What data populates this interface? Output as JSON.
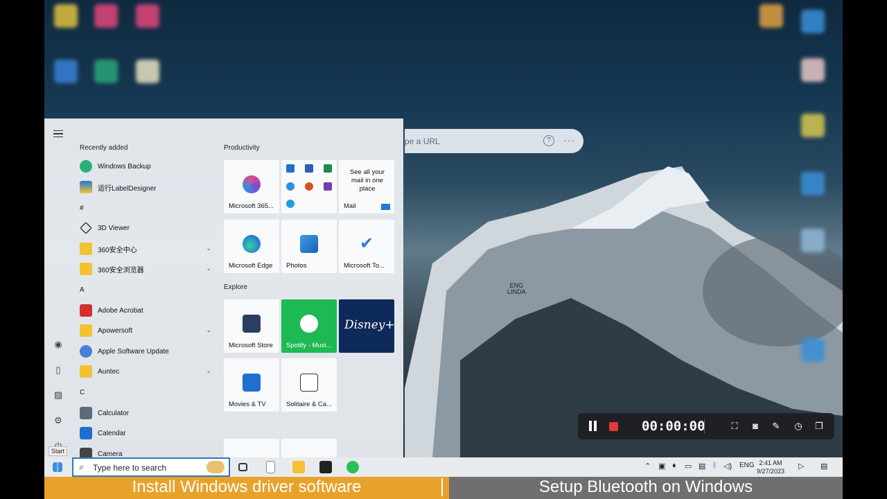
{
  "browser": {
    "url_placeholder": "pe a URL",
    "help_glyph": "?",
    "more_glyph": "···"
  },
  "wallpaper": {
    "location_label_1": "ENG",
    "location_label_2": "LINDA"
  },
  "recorder": {
    "timer": "00:00:00"
  },
  "start_menu": {
    "recently_added_header": "Recently added",
    "apps": [
      {
        "label": "Windows Backup",
        "color": "#2bb07a"
      },
      {
        "label": "运行LabelDesigner",
        "color": "#1f7ad6"
      },
      {
        "letter": "#"
      },
      {
        "label": "3D Viewer",
        "color": "#333333"
      },
      {
        "label": "360安全中心",
        "color": "#f2c233",
        "expandable": true
      },
      {
        "label": "360安全浏览器",
        "color": "#f2c233",
        "expandable": true
      },
      {
        "letter": "A"
      },
      {
        "label": "Adobe Acrobat",
        "color": "#d32f2f"
      },
      {
        "label": "Apowersoft",
        "color": "#f2c233",
        "expandable": true
      },
      {
        "label": "Apple Software Update",
        "color": "#4a7fd6"
      },
      {
        "label": "Auntec",
        "color": "#f2c233",
        "expandable": true
      },
      {
        "letter": "C"
      },
      {
        "label": "Calculator",
        "color": "#5b6b7b"
      },
      {
        "label": "Calendar",
        "color": "#1f6fd0"
      },
      {
        "label": "Camera",
        "color": "#444444"
      }
    ],
    "groups": [
      {
        "title": "Productivity"
      },
      {
        "title": "Explore"
      }
    ],
    "tiles": {
      "m365": "Microsoft 365...",
      "mail_promo": "See all your mail in one place",
      "mail": "Mail",
      "edge": "Microsoft Edge",
      "photos": "Photos",
      "todo": "Microsoft To...",
      "store": "Microsoft Store",
      "spotify": "Spotify - Musi...",
      "disney": "Disney+",
      "movies": "Movies & TV",
      "solitaire": "Solitaire & Ca..."
    }
  },
  "taskbar": {
    "start_tooltip": "Start",
    "search_placeholder": "Type here to search",
    "language": "ENG",
    "time": "2:41 AM",
    "date": "9/27/2023"
  },
  "banner": {
    "left": "Install Windows driver software",
    "right": "Setup Bluetooth on Windows"
  }
}
